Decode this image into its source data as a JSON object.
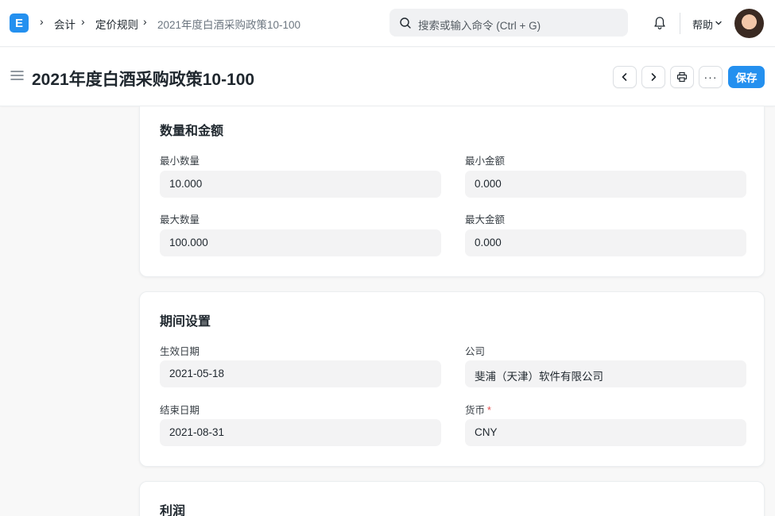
{
  "navbar": {
    "logo_letter": "E",
    "breadcrumbs": [
      "会计",
      "定价规则",
      "2021年度白酒采购政策10-100"
    ],
    "search_placeholder": "搜索或输入命令 (Ctrl + G)",
    "help_label": "帮助"
  },
  "page": {
    "title": "2021年度白酒采购政策10-100",
    "save_label": "保存"
  },
  "sections": {
    "qty_amount": {
      "title": "数量和金额",
      "min_qty_label": "最小数量",
      "min_qty_value": "10.000",
      "min_amt_label": "最小金额",
      "min_amt_value": "0.000",
      "max_qty_label": "最大数量",
      "max_qty_value": "100.000",
      "max_amt_label": "最大金额",
      "max_amt_value": "0.000"
    },
    "period": {
      "title": "期间设置",
      "valid_from_label": "生效日期",
      "valid_from_value": "2021-05-18",
      "company_label": "公司",
      "company_value": "斐浦（天津）软件有限公司",
      "valid_upto_label": "结束日期",
      "valid_upto_value": "2021-08-31",
      "currency_label": "货币",
      "currency_required": "*",
      "currency_value": "CNY"
    },
    "margin": {
      "title": "利润"
    }
  },
  "colors": {
    "primary": "#2490ef",
    "required": "#e24c4c",
    "input_bg": "#f3f3f4"
  }
}
